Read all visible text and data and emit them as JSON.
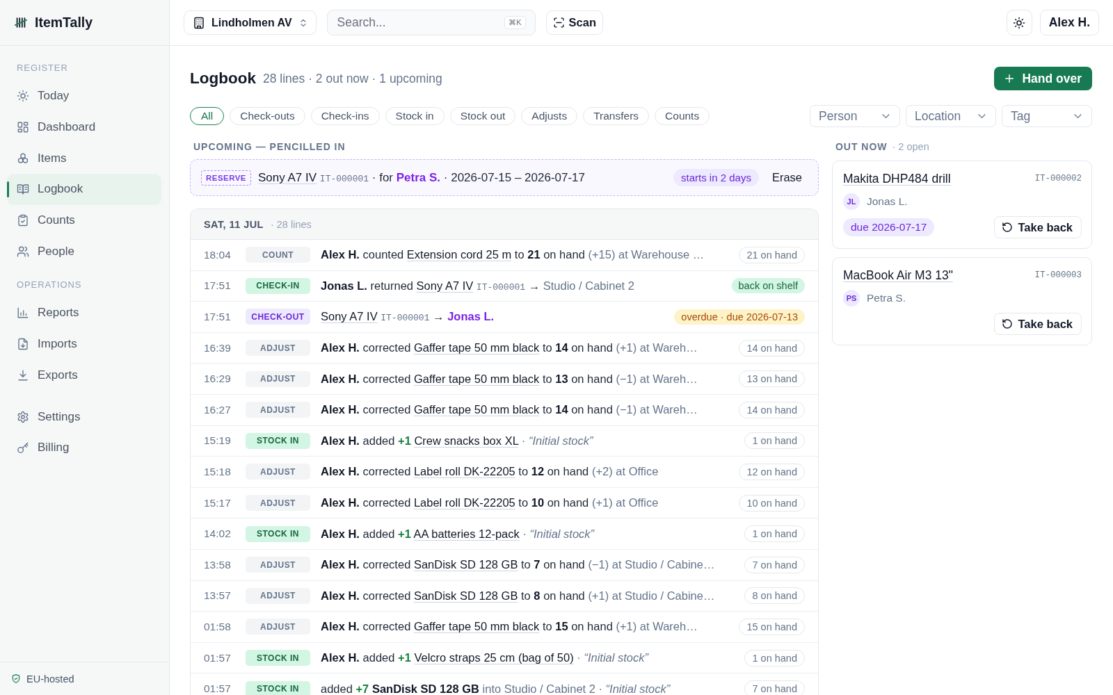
{
  "sidebar": {
    "brand": "ItemTally",
    "sections": [
      {
        "label": "REGISTER",
        "items": [
          {
            "label": "Today",
            "selected": false
          },
          {
            "label": "Dashboard",
            "selected": false
          },
          {
            "label": "Items",
            "selected": false
          },
          {
            "label": "Logbook",
            "selected": true
          },
          {
            "label": "Counts",
            "selected": false
          },
          {
            "label": "People",
            "selected": false
          }
        ]
      },
      {
        "label": "OPERATIONS",
        "items": [
          {
            "label": "Reports",
            "selected": false
          },
          {
            "label": "Imports",
            "selected": false
          },
          {
            "label": "Exports",
            "selected": false
          }
        ]
      },
      {
        "items": [
          {
            "label": "Settings",
            "selected": false
          },
          {
            "label": "Billing",
            "selected": false
          }
        ]
      }
    ],
    "footer": "EU-hosted"
  },
  "topbar": {
    "location": "Lindholmen AV",
    "search": {
      "placeholder": "Search...",
      "shortcut": "⌘K"
    },
    "scan": "Scan",
    "user": "Alex H."
  },
  "header": {
    "title": "Logbook",
    "summary": "28 lines · 2 out now · 1 upcoming",
    "action": "Hand over"
  },
  "filters": [
    {
      "label": "All",
      "selected": true
    },
    {
      "label": "Check-outs",
      "selected": false
    },
    {
      "label": "Check-ins",
      "selected": false
    },
    {
      "label": "Stock in",
      "selected": false
    },
    {
      "label": "Stock out",
      "selected": false
    },
    {
      "label": "Adjusts",
      "selected": false
    },
    {
      "label": "Transfers",
      "selected": false
    },
    {
      "label": "Counts",
      "selected": false
    }
  ],
  "dropdowns": [
    {
      "placeholder": "Person"
    },
    {
      "placeholder": "Location"
    },
    {
      "placeholder": "Tag"
    }
  ],
  "upcoming": {
    "heading": "UPCOMING — PENCILLED IN",
    "entries": [
      {
        "badge": "RESERVE",
        "parts": [
          {
            "kind": "item",
            "text": "Sony A7 IV"
          },
          {
            "kind": "code",
            "text": "IT-000001"
          },
          {
            "kind": "text",
            "text": "· for"
          },
          {
            "kind": "person",
            "text": "Petra S."
          },
          {
            "kind": "text",
            "text": "· 2026-07-15 – 2026-07-17"
          }
        ],
        "tag": "starts in 2 days",
        "action": "Erase"
      }
    ]
  },
  "log": {
    "day": "SAT, 11 JUL",
    "count": "· 28 lines",
    "rows": [
      {
        "time": "18:04",
        "type": {
          "kind": "count",
          "label": "COUNT"
        },
        "parts": [
          {
            "kind": "actor",
            "text": "Alex H."
          },
          {
            "kind": "text",
            "text": "counted"
          },
          {
            "kind": "item",
            "text": "Extension cord 25 m"
          },
          {
            "kind": "text",
            "text": "to"
          },
          {
            "kind": "strong",
            "text": "21"
          },
          {
            "kind": "text",
            "text": "on hand"
          },
          {
            "kind": "muted",
            "text": "(+15) at Warehouse …"
          }
        ],
        "status": {
          "kind": "stock",
          "text": "21 on hand"
        }
      },
      {
        "time": "17:51",
        "type": {
          "kind": "check-in",
          "label": "CHECK-IN"
        },
        "parts": [
          {
            "kind": "actor",
            "text": "Jonas L."
          },
          {
            "kind": "text",
            "text": "returned"
          },
          {
            "kind": "item",
            "text": "Sony A7 IV"
          },
          {
            "kind": "code",
            "text": "IT-000001"
          },
          {
            "kind": "text",
            "text": "→"
          },
          {
            "kind": "muted",
            "text": "Studio / Cabinet 2"
          }
        ],
        "status": {
          "kind": "ok",
          "text": "back on shelf"
        }
      },
      {
        "time": "17:51",
        "type": {
          "kind": "check-out",
          "label": "CHECK-OUT"
        },
        "parts": [
          {
            "kind": "item",
            "text": "Sony A7 IV"
          },
          {
            "kind": "code",
            "text": "IT-000001"
          },
          {
            "kind": "text",
            "text": "→"
          },
          {
            "kind": "person",
            "text": "Jonas L."
          }
        ],
        "status": {
          "kind": "overdue",
          "text": "overdue · due 2026-07-13"
        }
      },
      {
        "time": "16:39",
        "type": {
          "kind": "adjust",
          "label": "ADJUST"
        },
        "parts": [
          {
            "kind": "actor",
            "text": "Alex H."
          },
          {
            "kind": "text",
            "text": "corrected"
          },
          {
            "kind": "item",
            "text": "Gaffer tape 50 mm black"
          },
          {
            "kind": "text",
            "text": "to"
          },
          {
            "kind": "strong",
            "text": "14"
          },
          {
            "kind": "text",
            "text": "on hand"
          },
          {
            "kind": "muted",
            "text": "(+1) at Wareh…"
          }
        ],
        "status": {
          "kind": "stock",
          "text": "14 on hand"
        }
      },
      {
        "time": "16:29",
        "type": {
          "kind": "adjust",
          "label": "ADJUST"
        },
        "parts": [
          {
            "kind": "actor",
            "text": "Alex H."
          },
          {
            "kind": "text",
            "text": "corrected"
          },
          {
            "kind": "item",
            "text": "Gaffer tape 50 mm black"
          },
          {
            "kind": "text",
            "text": "to"
          },
          {
            "kind": "strong",
            "text": "13"
          },
          {
            "kind": "text",
            "text": "on hand"
          },
          {
            "kind": "muted",
            "text": "(−1) at Wareh…"
          }
        ],
        "status": {
          "kind": "stock",
          "text": "13 on hand"
        }
      },
      {
        "time": "16:27",
        "type": {
          "kind": "adjust",
          "label": "ADJUST"
        },
        "parts": [
          {
            "kind": "actor",
            "text": "Alex H."
          },
          {
            "kind": "text",
            "text": "corrected"
          },
          {
            "kind": "item",
            "text": "Gaffer tape 50 mm black"
          },
          {
            "kind": "text",
            "text": "to"
          },
          {
            "kind": "strong",
            "text": "14"
          },
          {
            "kind": "text",
            "text": "on hand"
          },
          {
            "kind": "muted",
            "text": "(−1) at Wareh…"
          }
        ],
        "status": {
          "kind": "stock",
          "text": "14 on hand"
        }
      },
      {
        "time": "15:19",
        "type": {
          "kind": "stock-in",
          "label": "STOCK IN"
        },
        "parts": [
          {
            "kind": "actor",
            "text": "Alex H."
          },
          {
            "kind": "text",
            "text": "added"
          },
          {
            "kind": "plus",
            "text": "+1"
          },
          {
            "kind": "item",
            "text": "Crew snacks box XL"
          },
          {
            "kind": "muted",
            "text": "·"
          },
          {
            "kind": "note",
            "text": "“Initial stock”"
          }
        ],
        "status": {
          "kind": "stock",
          "text": "1 on hand"
        }
      },
      {
        "time": "15:18",
        "type": {
          "kind": "adjust",
          "label": "ADJUST"
        },
        "parts": [
          {
            "kind": "actor",
            "text": "Alex H."
          },
          {
            "kind": "text",
            "text": "corrected"
          },
          {
            "kind": "item",
            "text": "Label roll DK-22205"
          },
          {
            "kind": "text",
            "text": "to"
          },
          {
            "kind": "strong",
            "text": "12"
          },
          {
            "kind": "text",
            "text": "on hand"
          },
          {
            "kind": "muted",
            "text": "(+2) at Office"
          }
        ],
        "status": {
          "kind": "stock",
          "text": "12 on hand"
        }
      },
      {
        "time": "15:17",
        "type": {
          "kind": "adjust",
          "label": "ADJUST"
        },
        "parts": [
          {
            "kind": "actor",
            "text": "Alex H."
          },
          {
            "kind": "text",
            "text": "corrected"
          },
          {
            "kind": "item",
            "text": "Label roll DK-22205"
          },
          {
            "kind": "text",
            "text": "to"
          },
          {
            "kind": "strong",
            "text": "10"
          },
          {
            "kind": "text",
            "text": "on hand"
          },
          {
            "kind": "muted",
            "text": "(+1) at Office"
          }
        ],
        "status": {
          "kind": "stock",
          "text": "10 on hand"
        }
      },
      {
        "time": "14:02",
        "type": {
          "kind": "stock-in",
          "label": "STOCK IN"
        },
        "parts": [
          {
            "kind": "actor",
            "text": "Alex H."
          },
          {
            "kind": "text",
            "text": "added"
          },
          {
            "kind": "plus",
            "text": "+1"
          },
          {
            "kind": "item",
            "text": "AA batteries 12-pack"
          },
          {
            "kind": "muted",
            "text": "·"
          },
          {
            "kind": "note",
            "text": "“Initial stock”"
          }
        ],
        "status": {
          "kind": "stock",
          "text": "1 on hand"
        }
      },
      {
        "time": "13:58",
        "type": {
          "kind": "adjust",
          "label": "ADJUST"
        },
        "parts": [
          {
            "kind": "actor",
            "text": "Alex H."
          },
          {
            "kind": "text",
            "text": "corrected"
          },
          {
            "kind": "item",
            "text": "SanDisk SD 128 GB"
          },
          {
            "kind": "text",
            "text": "to"
          },
          {
            "kind": "strong",
            "text": "7"
          },
          {
            "kind": "text",
            "text": "on hand"
          },
          {
            "kind": "muted",
            "text": "(−1) at Studio / Cabine…"
          }
        ],
        "status": {
          "kind": "stock",
          "text": "7 on hand"
        }
      },
      {
        "time": "13:57",
        "type": {
          "kind": "adjust",
          "label": "ADJUST"
        },
        "parts": [
          {
            "kind": "actor",
            "text": "Alex H."
          },
          {
            "kind": "text",
            "text": "corrected"
          },
          {
            "kind": "item",
            "text": "SanDisk SD 128 GB"
          },
          {
            "kind": "text",
            "text": "to"
          },
          {
            "kind": "strong",
            "text": "8"
          },
          {
            "kind": "text",
            "text": "on hand"
          },
          {
            "kind": "muted",
            "text": "(+1) at Studio / Cabine…"
          }
        ],
        "status": {
          "kind": "stock",
          "text": "8 on hand"
        }
      },
      {
        "time": "01:58",
        "type": {
          "kind": "adjust",
          "label": "ADJUST"
        },
        "parts": [
          {
            "kind": "actor",
            "text": "Alex H."
          },
          {
            "kind": "text",
            "text": "corrected"
          },
          {
            "kind": "item",
            "text": "Gaffer tape 50 mm black"
          },
          {
            "kind": "text",
            "text": "to"
          },
          {
            "kind": "strong",
            "text": "15"
          },
          {
            "kind": "text",
            "text": "on hand"
          },
          {
            "kind": "muted",
            "text": "(+1) at Wareh…"
          }
        ],
        "status": {
          "kind": "stock",
          "text": "15 on hand"
        }
      },
      {
        "time": "01:57",
        "type": {
          "kind": "stock-in",
          "label": "STOCK IN"
        },
        "parts": [
          {
            "kind": "actor",
            "text": "Alex H."
          },
          {
            "kind": "text",
            "text": "added"
          },
          {
            "kind": "plus",
            "text": "+1"
          },
          {
            "kind": "item",
            "text": "Velcro straps 25 cm (bag of 50)"
          },
          {
            "kind": "muted",
            "text": "·"
          },
          {
            "kind": "note",
            "text": "“Initial stock”"
          }
        ],
        "status": {
          "kind": "stock",
          "text": "1 on hand"
        }
      },
      {
        "time": "01:57",
        "type": {
          "kind": "stock-in",
          "label": "STOCK IN"
        },
        "parts": [
          {
            "kind": "text",
            "text": "added"
          },
          {
            "kind": "plus",
            "text": "+7"
          },
          {
            "kind": "strong",
            "text": "SanDisk SD 128 GB"
          },
          {
            "kind": "muted",
            "text": "into Studio / Cabinet 2"
          },
          {
            "kind": "muted",
            "text": "·"
          },
          {
            "kind": "note",
            "text": "“Initial stock”"
          }
        ],
        "status": {
          "kind": "stock",
          "text": "7 on hand"
        }
      }
    ]
  },
  "out_now": {
    "heading": "OUT NOW",
    "count": "· 2 open",
    "cards": [
      {
        "name": "Makita DHP484 drill",
        "id": "IT-000002",
        "initials": "JL",
        "person": "Jonas L.",
        "due": "due 2026-07-17",
        "action": "Take back"
      },
      {
        "name": "MacBook Air M3 13\"",
        "id": "IT-000003",
        "initials": "PS",
        "person": "Petra S.",
        "action": "Take back"
      }
    ]
  }
}
